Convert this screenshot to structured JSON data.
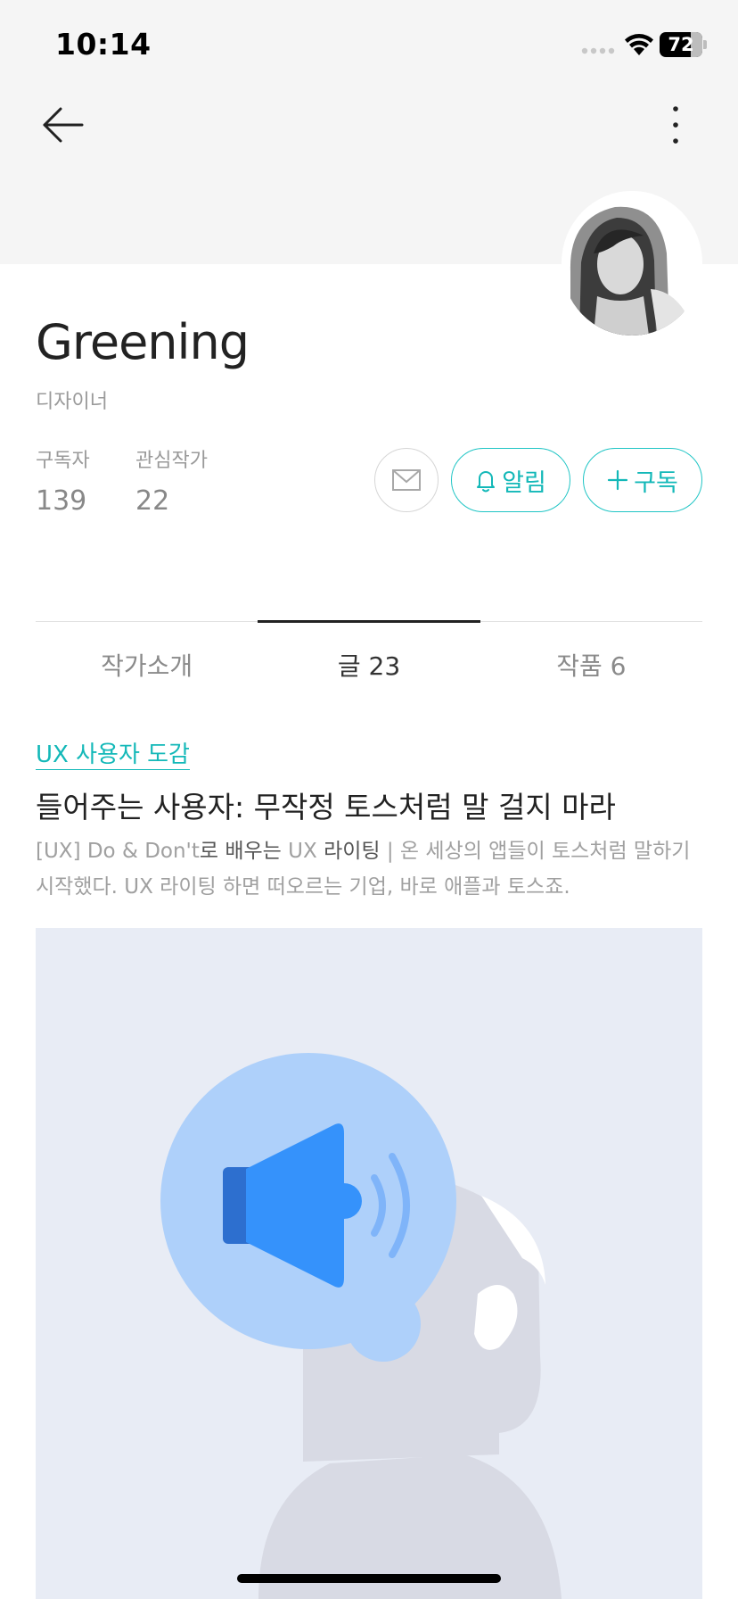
{
  "status_bar": {
    "time": "10:14",
    "battery": "72",
    "battery_level": 0.72
  },
  "nav": {
    "back_icon": "back-arrow-icon",
    "more_icon": "more-vertical-icon"
  },
  "profile": {
    "name": "Greening",
    "role": "디자이너",
    "stats": [
      {
        "label": "구독자",
        "value": "139"
      },
      {
        "label": "관심작가",
        "value": "22"
      }
    ],
    "actions": {
      "mail_icon": "mail-icon",
      "alarm_label": "알림",
      "alarm_icon": "bell-icon",
      "subscribe_label": "구독",
      "subscribe_icon": "plus-icon"
    }
  },
  "tabs": [
    {
      "label": "작가소개",
      "active": false
    },
    {
      "label": "글 23",
      "active": true
    },
    {
      "label": "작품 6",
      "active": false
    }
  ],
  "article": {
    "category": "UX 사용자 도감",
    "title": "들어주는 사용자: 무작정 토스처럼 말 걸지 마라",
    "excerpt": {
      "part1": "[UX] Do & Don't",
      "part2": "로 배우는 ",
      "part3": "UX ",
      "part4": "라이팅",
      "part5": " | 온 세상의 앱들이 토스처럼 말하기 시작했다.  UX 라이팅 하면 떠오르는 기업, 바로 애플과 토스죠."
    },
    "image_icon": "speaker-icon"
  },
  "colors": {
    "accent": "#13b8b8",
    "header_bg": "#f5f5f5",
    "image_bg": "#e8ecf5",
    "bubble": "#aed0fa",
    "speaker": "#3592fb"
  }
}
